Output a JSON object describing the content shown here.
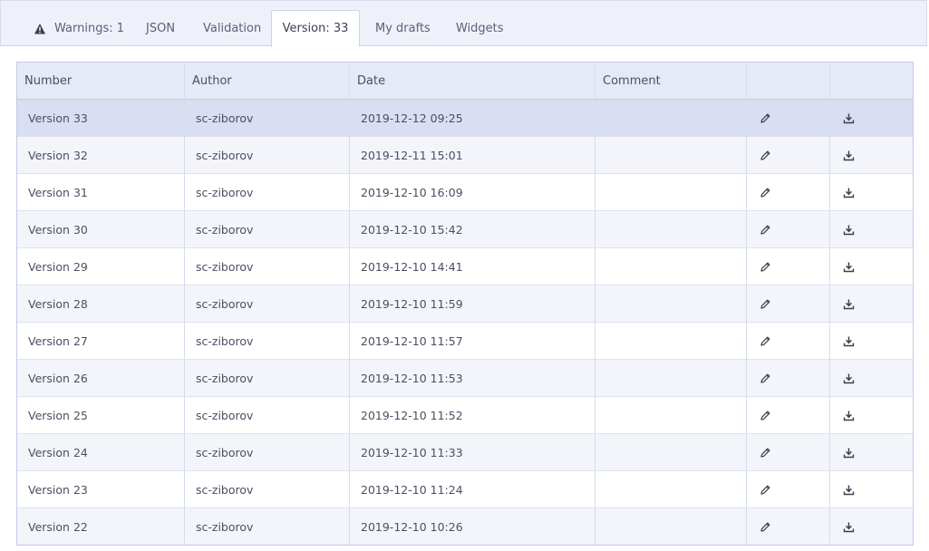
{
  "tabs": [
    {
      "label": "Warnings: 1",
      "active": false
    },
    {
      "label": "JSON",
      "active": false
    },
    {
      "label": "Validation",
      "active": false
    },
    {
      "label": "Version: 33",
      "active": true
    },
    {
      "label": "My drafts",
      "active": false
    },
    {
      "label": "Widgets",
      "active": false
    }
  ],
  "table": {
    "columns": [
      "Number",
      "Author",
      "Date",
      "Comment",
      "",
      ""
    ],
    "rows": [
      {
        "number": "Version 33",
        "author": "sc-ziborov",
        "date": "2019-12-12 09:25",
        "comment": ""
      },
      {
        "number": "Version 32",
        "author": "sc-ziborov",
        "date": "2019-12-11 15:01",
        "comment": ""
      },
      {
        "number": "Version 31",
        "author": "sc-ziborov",
        "date": "2019-12-10 16:09",
        "comment": ""
      },
      {
        "number": "Version 30",
        "author": "sc-ziborov",
        "date": "2019-12-10 15:42",
        "comment": ""
      },
      {
        "number": "Version 29",
        "author": "sc-ziborov",
        "date": "2019-12-10 14:41",
        "comment": ""
      },
      {
        "number": "Version 28",
        "author": "sc-ziborov",
        "date": "2019-12-10 11:59",
        "comment": ""
      },
      {
        "number": "Version 27",
        "author": "sc-ziborov",
        "date": "2019-12-10 11:57",
        "comment": ""
      },
      {
        "number": "Version 26",
        "author": "sc-ziborov",
        "date": "2019-12-10 11:53",
        "comment": ""
      },
      {
        "number": "Version 25",
        "author": "sc-ziborov",
        "date": "2019-12-10 11:52",
        "comment": ""
      },
      {
        "number": "Version 24",
        "author": "sc-ziborov",
        "date": "2019-12-10 11:33",
        "comment": ""
      },
      {
        "number": "Version 23",
        "author": "sc-ziborov",
        "date": "2019-12-10 11:24",
        "comment": ""
      },
      {
        "number": "Version 22",
        "author": "sc-ziborov",
        "date": "2019-12-10 10:26",
        "comment": ""
      }
    ],
    "selected_row": 0,
    "row_icons": [
      "pencil-icon",
      "download-icon"
    ]
  },
  "colors": {
    "header_bg": "#e6eaf6",
    "selected_row": "#d9def3",
    "border": "#c3cbe6"
  }
}
